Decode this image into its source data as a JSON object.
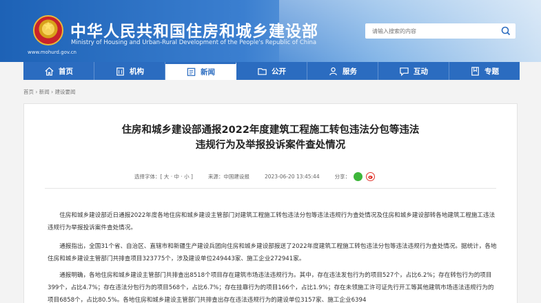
{
  "header": {
    "title": "中华人民共和国住房和城乡建设部",
    "subtitle": "Ministry of Housing and Urban-Rural Development of the People's Republic of China",
    "url": "www.mohurd.gov.cn",
    "search_placeholder": "请输入搜索的内容"
  },
  "nav": {
    "items": [
      {
        "label": "首页",
        "icon": "home-icon"
      },
      {
        "label": "机构",
        "icon": "building-icon"
      },
      {
        "label": "新闻",
        "icon": "news-icon",
        "active": true
      },
      {
        "label": "公开",
        "icon": "folder-icon"
      },
      {
        "label": "服务",
        "icon": "service-icon"
      },
      {
        "label": "互动",
        "icon": "chat-icon"
      },
      {
        "label": "专题",
        "icon": "topic-icon"
      }
    ]
  },
  "breadcrumb": [
    "首页",
    "新闻",
    "建设要闻"
  ],
  "article": {
    "title_line1": "住房和城乡建设部通报2022年度建筑工程施工转包违法分包等违法",
    "title_line2": "违规行为及举报投诉案件查处情况",
    "font_size_label": "选择字体：[ 大 · 中 · 小 ]",
    "source": "来源：中国建设报",
    "datetime": "2023-06-20 13:45:44",
    "share_label": "分享：",
    "paragraphs": [
      "住房和城乡建设部近日通报2022年度各地住房和城乡建设主管部门对建筑工程施工转包违法分包等违法违规行为查处情况及住房和城乡建设部转各地建筑工程施工违法违规行为举报投诉案件查处情况。",
      "通报指出，全国31个省、自治区、直辖市和新疆生产建设兵团向住房和城乡建设部报送了2022年度建筑工程施工转包违法分包等违法违规行为查处情况。据统计，各地住房和城乡建设主管部门共排查项目323775个，涉及建设单位249443家、施工企业272941家。",
      "通报明确，各地住房和城乡建设主管部门共排查出8518个项目存在建筑市场违法违规行为。其中，存在违法发包行为的项目527个，占比6.2%；存在转包行为的项目399个，占比4.7%；存在违法分包行为的项目568个，占比6.7%；存在挂靠行为的项目166个，占比1.9%；存在未领施工许可证先行开工等其他建筑市场违法违规行为的项目6858个，占比80.5%。各地住房和城乡建设主管部门共排查出存在违法违规行为的建设单位3157家、施工企业6394"
    ]
  },
  "colors": {
    "brand_blue": "#2b6cc0",
    "wechat_green": "#3db63a",
    "weibo_red": "#e0342c"
  }
}
